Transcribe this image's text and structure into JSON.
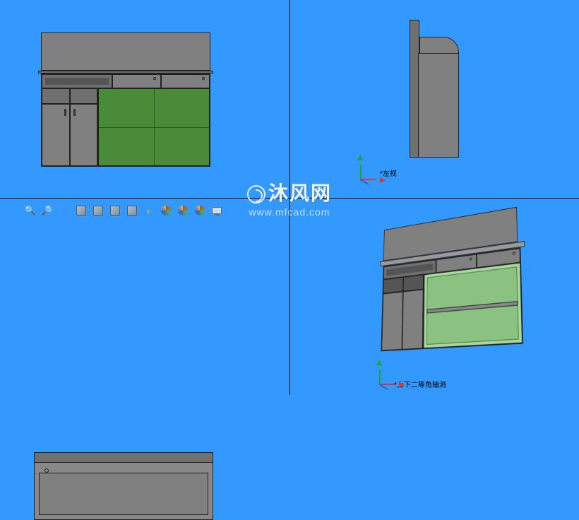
{
  "views": {
    "top_right_label": "*左视",
    "bottom_right_label": "*上下二等角轴测"
  },
  "watermark": {
    "title": "沐风网",
    "url": "www.mfcad.com"
  },
  "toolbar": {
    "items": [
      {
        "name": "zoom-in-icon"
      },
      {
        "name": "zoom-out-icon"
      },
      {
        "name": "zoom-window-icon"
      },
      {
        "name": "view-cube-1-icon"
      },
      {
        "name": "view-cube-2-icon"
      },
      {
        "name": "view-cube-3-icon"
      },
      {
        "name": "view-cube-4-icon"
      },
      {
        "name": "shade-mode-icon"
      },
      {
        "name": "color-view-1-icon"
      },
      {
        "name": "color-view-2-icon"
      },
      {
        "name": "color-view-3-icon"
      },
      {
        "name": "display-icon"
      }
    ]
  },
  "axes": {
    "x": "X",
    "y": "Y",
    "z": "Z"
  }
}
